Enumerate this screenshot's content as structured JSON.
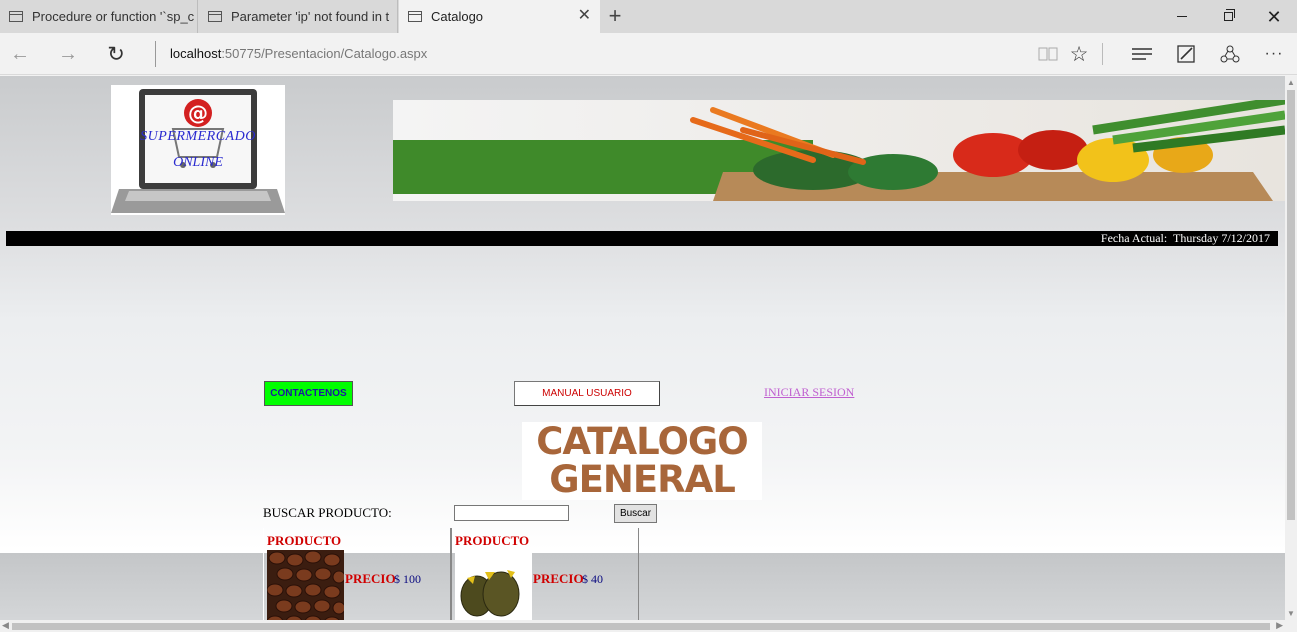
{
  "browser": {
    "tabs": [
      {
        "title": "Procedure or function '`sp_c"
      },
      {
        "title": "Parameter 'ip' not found in t"
      },
      {
        "title": "Catalogo"
      }
    ],
    "address": {
      "host": "localhost",
      "path": ":50775/Presentacion/Catalogo.aspx"
    }
  },
  "page": {
    "logo": {
      "line1": "SUPERMERCADO",
      "line2": "ONLINE"
    },
    "date_text": "Fecha Actual:  Thursday 7/12/2017",
    "menu": {
      "contact_label": "CONTACTENOS",
      "manual_label": "MANUAL USUARIO",
      "login_label": "INICIAR SESION"
    },
    "catalog_title": {
      "line1": "CATALOGO",
      "line2": "GENERAL"
    },
    "search": {
      "label": "BUSCAR PRODUCTO:",
      "value": "",
      "button_label": "Buscar"
    },
    "products": [
      {
        "heading": "PRODUCTO",
        "price_label": "PRECIO",
        "price_value": "$ 100",
        "image": "coffee-beans"
      },
      {
        "heading": "PRODUCTO",
        "price_label": "PRECIO",
        "price_value": "$ 40",
        "image": "durian-fruit"
      }
    ]
  },
  "colors": {
    "contact_button_bg": "#00ff00",
    "product_label": "#d00000",
    "price_value": "#0a0a80",
    "login_link": "#c060d0",
    "date_bar_bg": "#000000"
  }
}
